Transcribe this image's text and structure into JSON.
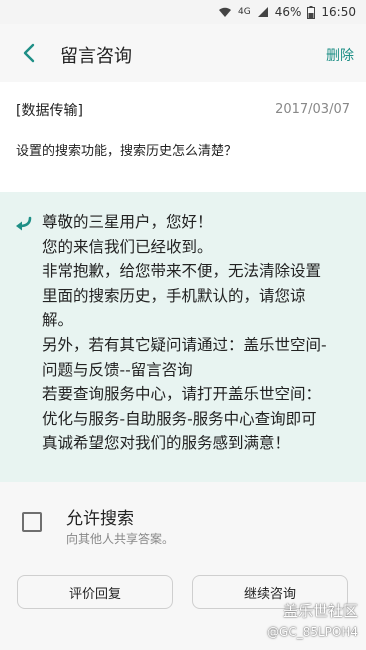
{
  "status_bar": {
    "network": "4G",
    "battery": "46%",
    "time": "16:50",
    "icons": [
      "wifi-icon",
      "signal-icon",
      "battery-icon"
    ]
  },
  "header": {
    "title": "留言咨询",
    "delete_label": "删除",
    "back_icon": "chevron-left-icon",
    "accent_color": "#1e8f86"
  },
  "question": {
    "category": "[数据传输]",
    "date": "2017/03/07",
    "text": "设置的搜索功能，搜索历史怎么清楚？"
  },
  "reply": {
    "icon": "reply-arrow-icon",
    "lines": [
      "尊敬的三星用户，您好！",
      "您的来信我们已经收到。",
      "非常抱歉，给您带来不便，无法清除设置",
      "里面的搜索历史，手机默认的，请您谅",
      "解。",
      "另外，若有其它疑问请通过：盖乐世空间-",
      "问题与反馈--留言咨询",
      "若要查询服务中心，请打开盖乐世空间：",
      "优化与服务-自助服务-服务中心查询即可",
      "真诚希望您对我们的服务感到满意！"
    ],
    "background_color": "#e8f4f1"
  },
  "allow_search": {
    "title": "允许搜索",
    "subtitle": "向其他人共享答案。",
    "checked": false
  },
  "buttons": {
    "rate_label": "评价回复",
    "continue_label": "继续咨询"
  },
  "watermark": {
    "brand": "盖乐世社区",
    "user": "@GC_85LPOH4"
  }
}
